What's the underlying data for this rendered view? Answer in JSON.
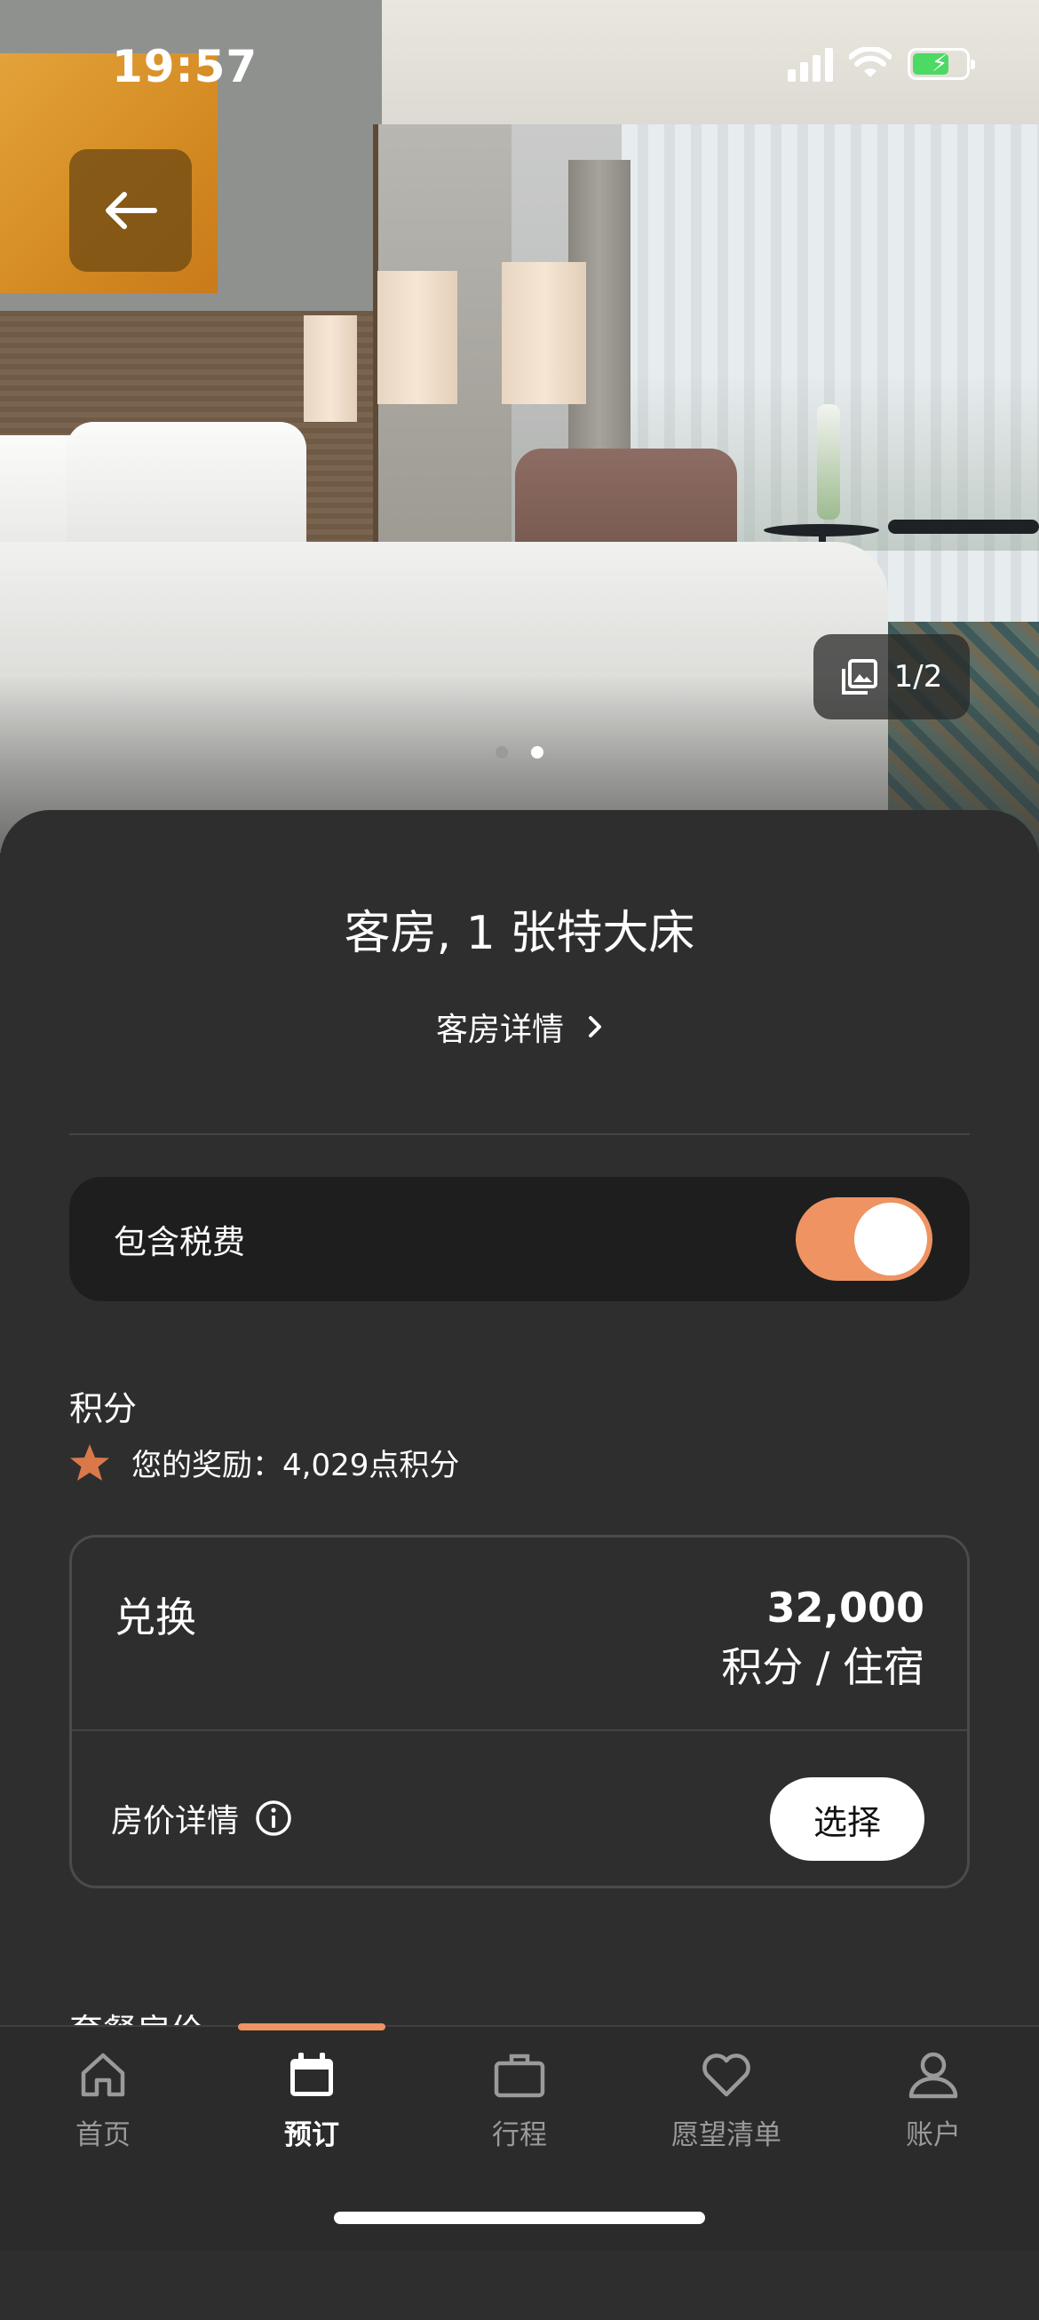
{
  "status_bar": {
    "time": "19:57"
  },
  "gallery": {
    "counter": "1/2",
    "page_count": 2,
    "active_page": 2
  },
  "room": {
    "title": "客房, 1 张特大床",
    "details_link": "客房详情"
  },
  "tax": {
    "label": "包含税费",
    "enabled": true
  },
  "points": {
    "heading": "积分",
    "reward_text": "您的奖励：4,029点积分"
  },
  "rate_card": {
    "redeem_label": "兑换",
    "points_value": "32,000",
    "per_label": "积分 / 住宿",
    "details_label": "房价详情",
    "select_label": "选择"
  },
  "next_section_title": "套餐房价",
  "tabs": [
    {
      "label": "首页",
      "icon": "home-icon",
      "active": false
    },
    {
      "label": "预订",
      "icon": "calendar-icon",
      "active": true
    },
    {
      "label": "行程",
      "icon": "briefcase-icon",
      "active": false
    },
    {
      "label": "愿望清单",
      "icon": "heart-icon",
      "active": false
    },
    {
      "label": "账户",
      "icon": "person-icon",
      "active": false
    }
  ],
  "colors": {
    "accent": "#ee9361",
    "background": "#2e2e2e",
    "tax_box": "#1e1e1e"
  }
}
